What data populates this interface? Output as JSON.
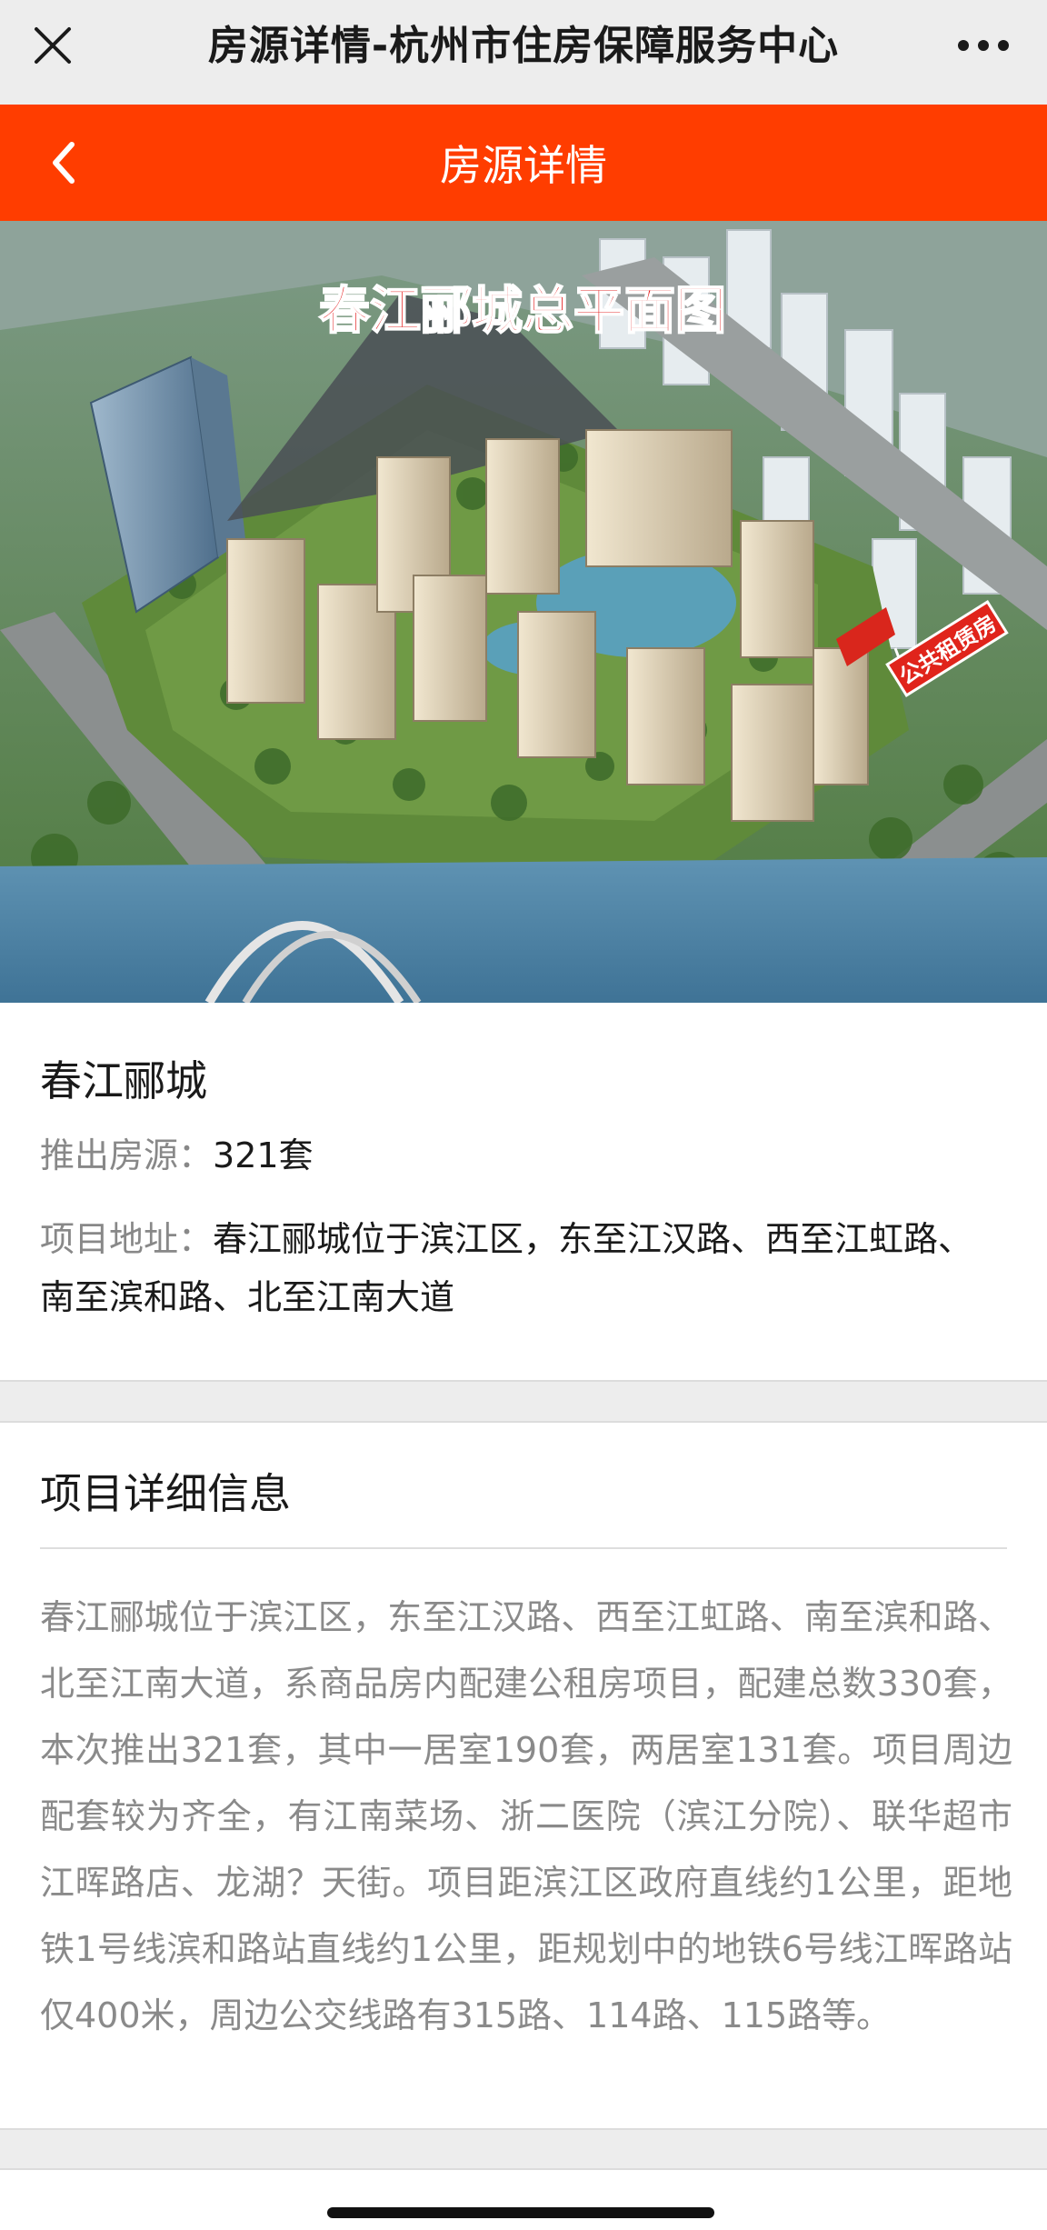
{
  "wechat_bar": {
    "title": "房源详情-杭州市住房保障服务中心"
  },
  "header": {
    "title": "房源详情"
  },
  "hero": {
    "image_title": "春江郦城总平面图",
    "tag_label": "公共租赁房"
  },
  "project": {
    "name": "春江郦城",
    "units_label": "推出房源：",
    "units_value": "321套",
    "address_label": "项目地址：",
    "address_value": "春江郦城位于滨江区，东至江汉路、西至江虹路、南至滨和路、北至江南大道"
  },
  "details": {
    "title": "项目详细信息",
    "text": "春江郦城位于滨江区，东至江汉路、西至江虹路、南至滨和路、北至江南大道，系商品房内配建公租房项目，配建总数330套，本次推出321套，其中一居室190套，两居室131套。项目周边配套较为齐全，有江南菜场、浙二医院（滨江分院）、联华超市江晖路店、龙湖？天街。项目距滨江区政府直线约1公里，距地铁1号线滨和路站直线约1公里，距规划中的地铁6号线江晖路站仅400米，周边公交线路有315路、114路、115路等。"
  },
  "colors": {
    "header_bg": "#ff3d00",
    "tag_red": "#e0241b"
  },
  "icons": {
    "close": "close-icon",
    "more": "more-icon",
    "back": "back-icon"
  }
}
